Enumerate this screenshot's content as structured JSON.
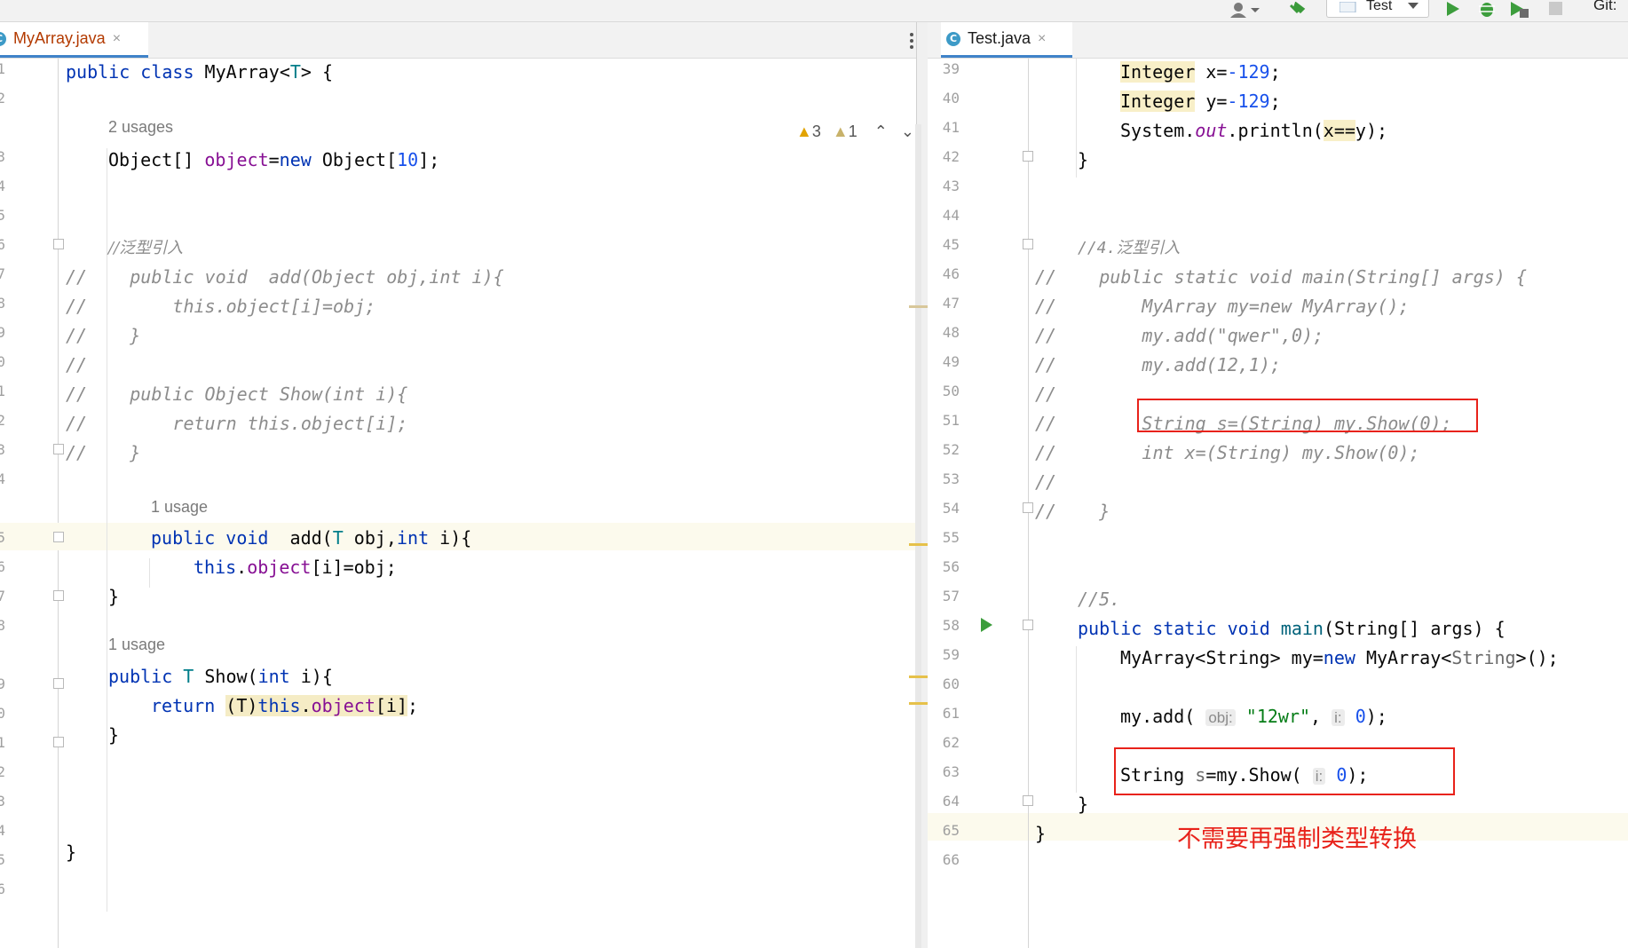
{
  "toolbar": {
    "run_config": "Test",
    "git_label": "Git:",
    "icons": [
      "user-icon",
      "hammer-icon",
      "run-icon",
      "debug-icon",
      "coverage-icon",
      "stop-icon"
    ]
  },
  "left": {
    "tab": {
      "icon_letter": "C",
      "label": "MyArray.java",
      "close": "×"
    },
    "warnings": {
      "warn_count": "3",
      "weak_count": "1"
    },
    "line_numbers": [
      "1",
      "2",
      "",
      "3",
      "4",
      "5",
      "6",
      "7",
      "8",
      "9",
      "0",
      "1",
      "2",
      "3",
      "4",
      "",
      "5",
      "6",
      "7",
      "8",
      "",
      "9",
      "0",
      "1",
      "2",
      "3",
      "4",
      "5",
      "6"
    ],
    "hints": {
      "usages2": "2 usages",
      "usage1a": "1 usage",
      "usage1b": "1 usage"
    },
    "code": {
      "l1_kw": "public class ",
      "l1_name": "MyArray<",
      "l1_T": "T",
      "l1_end": "> {",
      "l3_a": "Object[] ",
      "l3_b": "object",
      "l3_c": "=",
      "l3_d": "new ",
      "l3_e": "Object[",
      "l3_f": "10",
      "l3_g": "];",
      "l6": "//泛型引入",
      "l7": "//    public void  add(Object obj,int i){",
      "l8": "//        this.object[i]=obj;",
      "l9": "//    }",
      "l10": "//",
      "l11": "//    public Object Show(int i){",
      "l12": "//        return this.object[i];",
      "l13": "//    }",
      "l15_kw": "public void  ",
      "l15_fn": "add(",
      "l15_T": "T",
      "l15_a": " obj,",
      "l15_int": "int",
      "l15_b": " i){",
      "l16_this": "this",
      "l16_dot": ".",
      "l16_obj": "object",
      "l16_rest": "[i]=obj;",
      "l17": "}",
      "l19_kw": "public ",
      "l19_T": "T",
      "l19_rest": " Show(",
      "l19_int": "int",
      "l19_end": " i){",
      "l20_kw": "return ",
      "l20_cast": "(T)",
      "l20_this": "this",
      "l20_dot": ".",
      "l20_obj": "object",
      "l20_idx": "[i]",
      "l20_end": ";",
      "l21": "}",
      "l25": "}"
    }
  },
  "right": {
    "tab": {
      "icon_letter": "C",
      "label": "Test.java",
      "close": "×"
    },
    "line_numbers": [
      "39",
      "40",
      "41",
      "42",
      "43",
      "44",
      "45",
      "46",
      "47",
      "48",
      "49",
      "50",
      "51",
      "52",
      "53",
      "54",
      "55",
      "56",
      "57",
      "58",
      "59",
      "60",
      "61",
      "62",
      "63",
      "64",
      "65",
      "66"
    ],
    "code": {
      "l39_t": "Integer",
      "l39_rest": " x=",
      "l39_n": "-129",
      "l39_end": ";",
      "l40_t": "Integer",
      "l40_rest": " y=",
      "l40_n": "-129",
      "l40_end": ";",
      "l41_a": "System.",
      "l41_out": "out",
      "l41_b": ".println(",
      "l41_eq": "x==",
      "l41_c": "y);",
      "l42": "}",
      "l45": "//4.泛型引入",
      "l46": "//    public static void main(String[] args) {",
      "l47": "//        MyArray my=new MyArray();",
      "l48": "//        my.add(\"qwer\",0);",
      "l49": "//        my.add(12,1);",
      "l50": "//",
      "l51": "//        String s=(String) my.Show(0);",
      "l52": "//        int x=(String) my.Show(0);",
      "l53": "//",
      "l54": "//    }",
      "l57": "//5.",
      "l58_kw": "public static void ",
      "l58_fn": "main",
      "l58_rest": "(String[] args) {",
      "l59_a": "MyArray<String> my=",
      "l59_new": "new",
      "l59_b": " MyArray<",
      "l59_str": "String",
      "l59_c": ">();",
      "l61_a": "my.add( ",
      "l61_hint": "obj:",
      "l61_sp": " ",
      "l61_s": "\"12wr\"",
      "l61_b": ", ",
      "l61_hint2": "i:",
      "l61_sp2": " ",
      "l61_n": "0",
      "l61_end": ");",
      "l63_a": "String ",
      "l63_s": "s",
      "l63_b": "=my.Show( ",
      "l63_hint": "i:",
      "l63_sp": " ",
      "l63_n": "0",
      "l63_end": ");",
      "l64": "}",
      "l65": "}"
    },
    "annotation": "不需要再强制类型转换"
  }
}
